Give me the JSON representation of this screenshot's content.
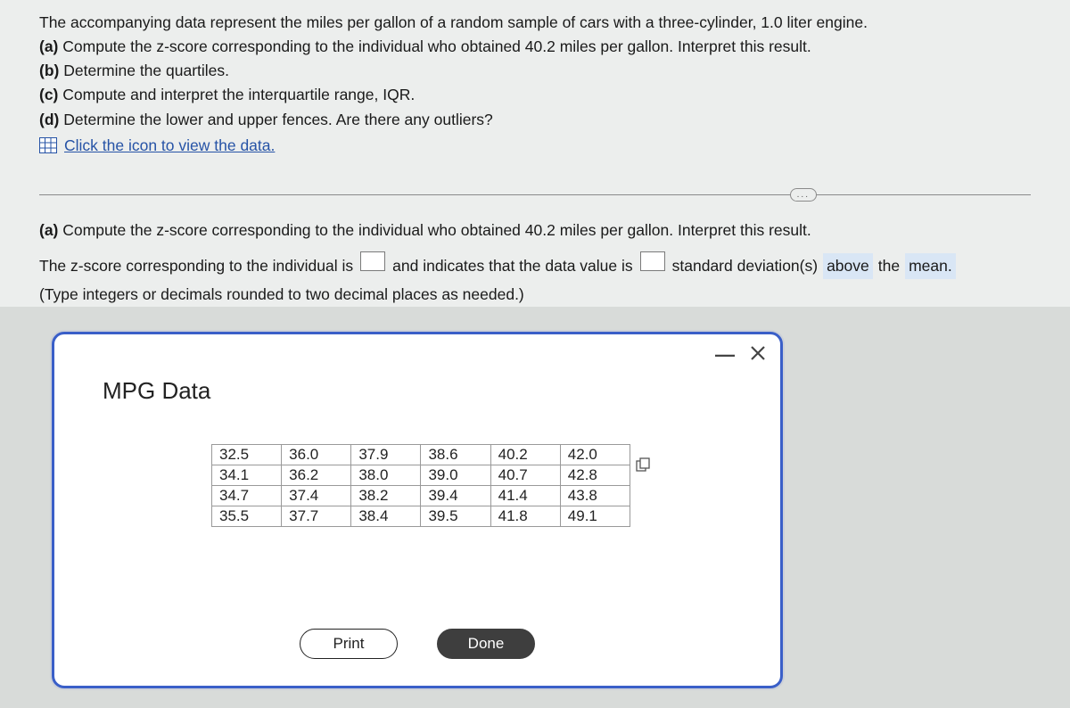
{
  "question": {
    "intro": "The accompanying data represent the miles per gallon of a random sample of cars with a three-cylinder, 1.0 liter engine.",
    "parts": {
      "a_label": "(a)",
      "a_text": "Compute the z-score corresponding to the individual who obtained 40.2 miles per gallon. Interpret this result.",
      "b_label": "(b)",
      "b_text": "Determine the quartiles.",
      "c_label": "(c)",
      "c_text": "Compute and interpret the interquartile range, IQR.",
      "d_label": "(d)",
      "d_text": "Determine the lower and upper fences. Are there any outliers?"
    },
    "data_link": "Click the icon to view the data."
  },
  "answer_section": {
    "heading_label": "(a)",
    "heading_text": "Compute the z-score corresponding to the individual who obtained 40.2 miles per gallon. Interpret this result.",
    "sentence_1a": "The z-score corresponding to the individual is",
    "sentence_1b": "and indicates that the data value is",
    "sentence_1c": "standard deviation(s)",
    "dropdown_value": "above",
    "sentence_1d": "the",
    "dropdown_value2": "mean.",
    "hint": "(Type integers or decimals rounded to two decimal places as needed.)"
  },
  "modal": {
    "title": "MPG Data",
    "table": [
      [
        "32.5",
        "36.0",
        "37.9",
        "38.6",
        "40.2",
        "42.0"
      ],
      [
        "34.1",
        "36.2",
        "38.0",
        "39.0",
        "40.7",
        "42.8"
      ],
      [
        "34.7",
        "37.4",
        "38.2",
        "39.4",
        "41.4",
        "43.8"
      ],
      [
        "35.5",
        "37.7",
        "38.4",
        "39.5",
        "41.8",
        "49.1"
      ]
    ],
    "buttons": {
      "print": "Print",
      "done": "Done"
    }
  },
  "ellipsis": "..."
}
